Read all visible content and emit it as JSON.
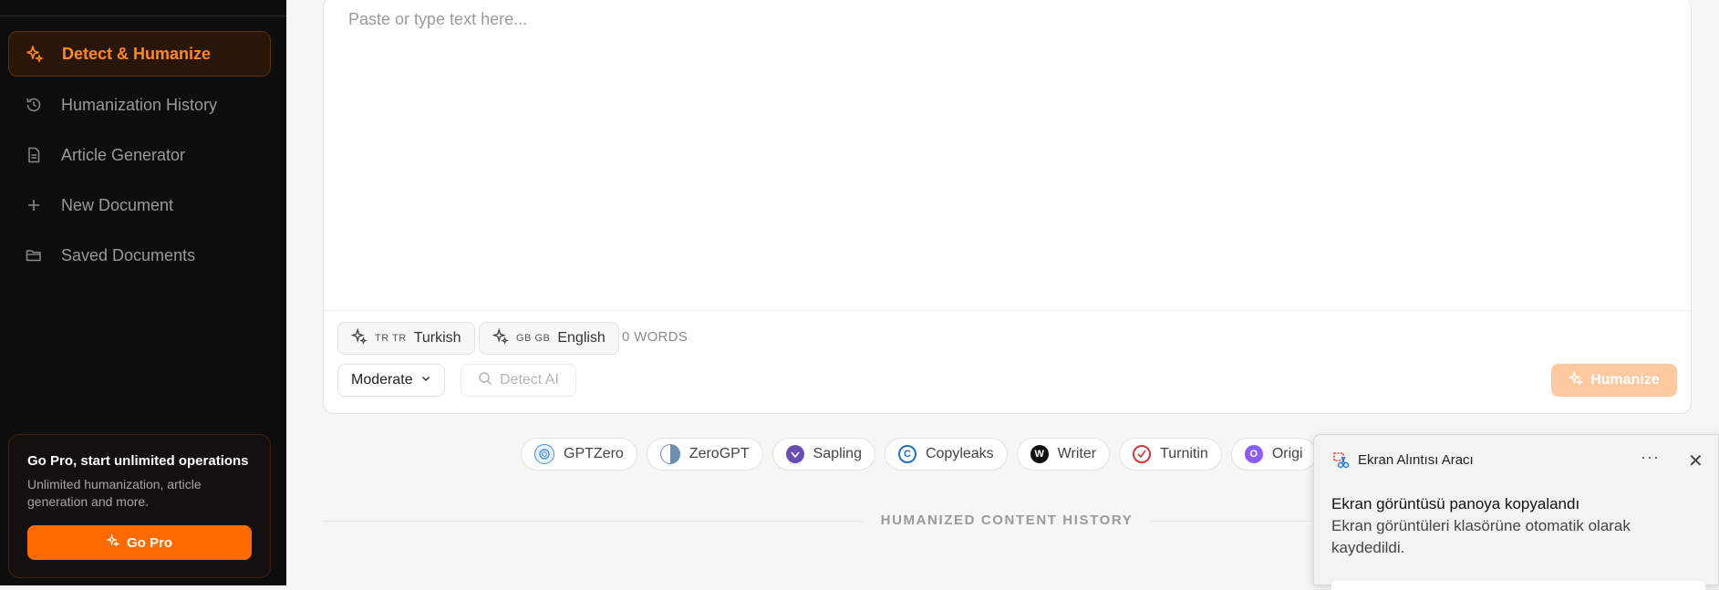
{
  "sidebar": {
    "items": [
      {
        "label": "Detect & Humanize",
        "icon": "sparkles-icon",
        "active": true
      },
      {
        "label": "Humanization History",
        "icon": "history-icon",
        "active": false
      },
      {
        "label": "Article Generator",
        "icon": "document-icon",
        "active": false
      },
      {
        "label": "New Document",
        "icon": "plus-icon",
        "active": false
      },
      {
        "label": "Saved Documents",
        "icon": "folder-icon",
        "active": false
      }
    ],
    "promo": {
      "title": "Go Pro, start unlimited operations",
      "description": "Unlimited humanization, article generation and more.",
      "button_label": "Go Pro"
    }
  },
  "editor": {
    "placeholder": "Paste or type text here...",
    "value": "",
    "source_language": {
      "code": "TR TR",
      "label": "Turkish"
    },
    "target_language": {
      "code": "GB GB",
      "label": "English"
    },
    "word_count": "0 WORDS",
    "mode": "Moderate",
    "detect_label": "Detect AI",
    "humanize_label": "Humanize"
  },
  "detectors": [
    {
      "name": "GPTZero",
      "color": "#4a90e2"
    },
    {
      "name": "ZeroGPT",
      "color": "#6b8fb3"
    },
    {
      "name": "Sapling",
      "color": "#6a4fb3"
    },
    {
      "name": "Copyleaks",
      "color": "#1f6fd1"
    },
    {
      "name": "Writer",
      "color": "#111111"
    },
    {
      "name": "Turnitin",
      "color": "#d9343a"
    },
    {
      "name": "Origi",
      "color": "#8b5cf6"
    }
  ],
  "history": {
    "heading": "HUMANIZED CONTENT HISTORY"
  },
  "toast": {
    "app_name": "Ekran Alıntısı Aracı",
    "title": "Ekran görüntüsü panoya kopyalandı",
    "body": "Ekran görüntüleri klasörüne otomatik olarak kaydedildi.",
    "more": "···",
    "close": "✕"
  },
  "colors": {
    "accent": "#ff6a00",
    "sidebar_bg": "#0d0d0d",
    "active_text": "#ff8a1f"
  }
}
